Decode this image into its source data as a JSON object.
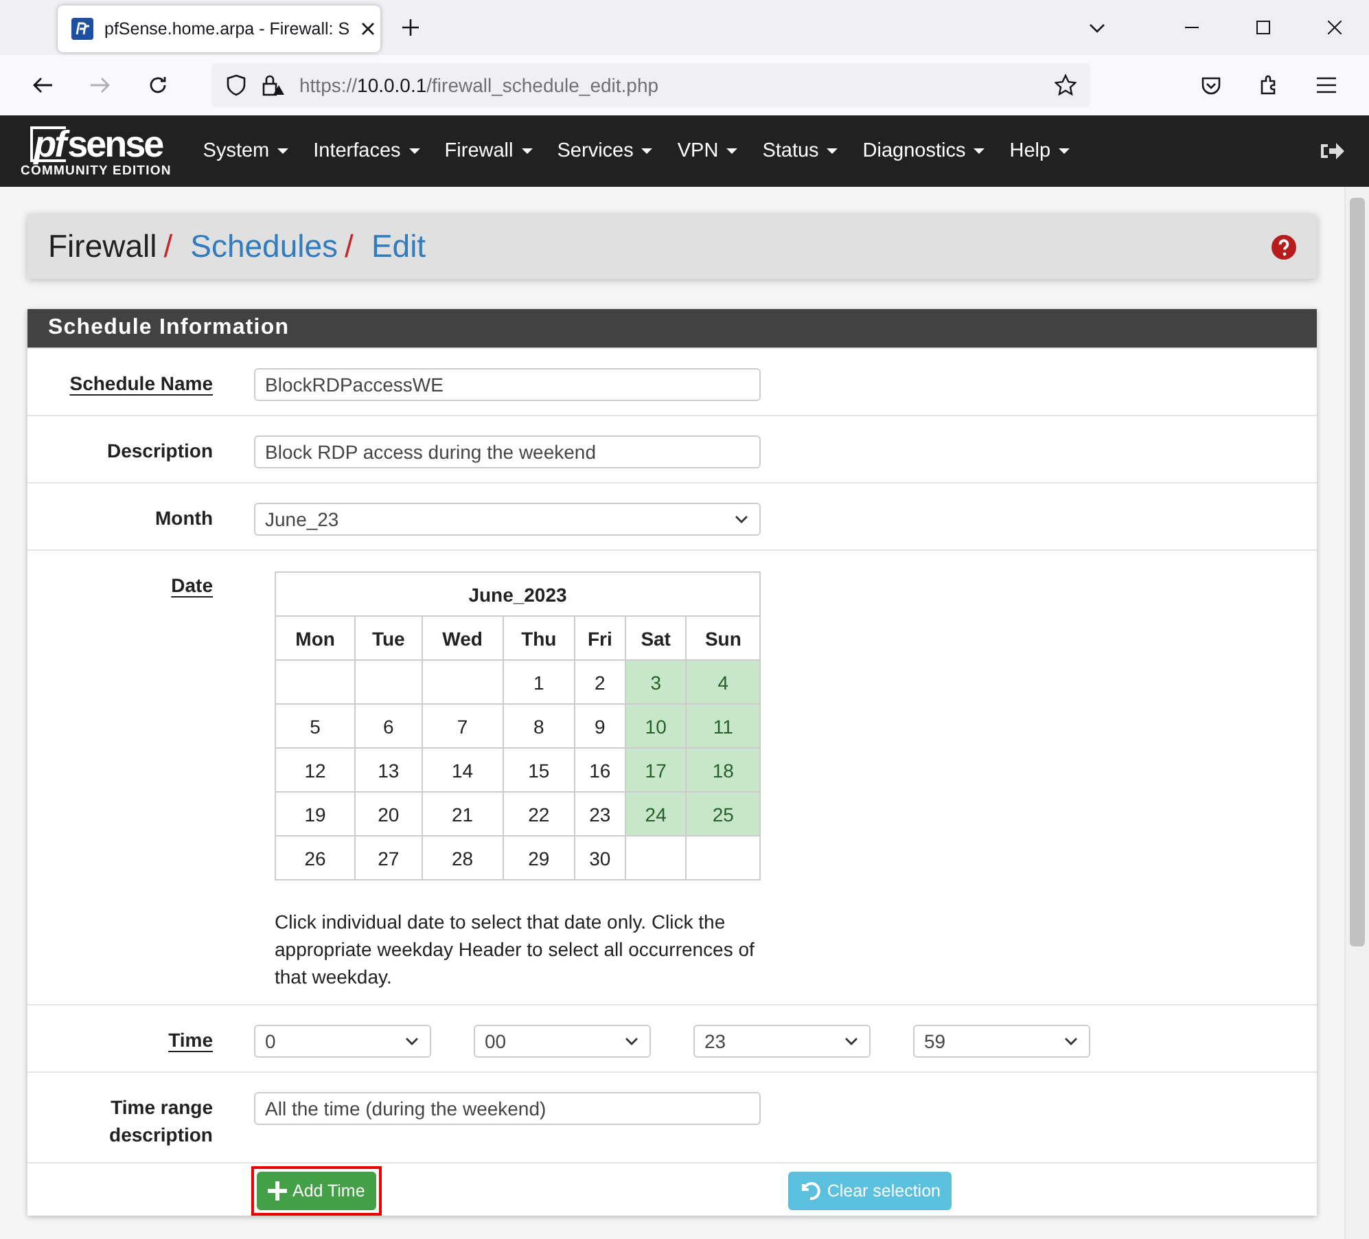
{
  "browser": {
    "tab_title": "pfSense.home.arpa - Firewall: S",
    "url": "https://10.0.0.1/firewall_schedule_edit.php"
  },
  "nav": {
    "logo": {
      "mark": "pf",
      "name": "sense",
      "edition": "COMMUNITY EDITION"
    },
    "items": [
      {
        "label": "System"
      },
      {
        "label": "Interfaces"
      },
      {
        "label": "Firewall"
      },
      {
        "label": "Services"
      },
      {
        "label": "VPN"
      },
      {
        "label": "Status"
      },
      {
        "label": "Diagnostics"
      },
      {
        "label": "Help"
      }
    ]
  },
  "breadcrumb": [
    {
      "label": "Firewall",
      "kind": "text",
      "separator": "/"
    },
    {
      "label": "Schedules",
      "kind": "link",
      "separator": "/"
    },
    {
      "label": "Edit",
      "kind": "link"
    }
  ],
  "panel": {
    "title": "Schedule Information",
    "rows": [
      {
        "kind": "text",
        "label": "Schedule Name",
        "required": true,
        "value": "BlockRDPaccessWE"
      },
      {
        "kind": "text",
        "label": "Description",
        "required": false,
        "value": "Block RDP access during the weekend"
      },
      {
        "kind": "select",
        "label": "Month",
        "required": false,
        "value": "June_23"
      },
      {
        "kind": "calendar",
        "label": "Date",
        "required": true,
        "calendar": {
          "title": "June_2023",
          "headers": [
            "Mon",
            "Tue",
            "Wed",
            "Thu",
            "Fri",
            "Sat",
            "Sun"
          ],
          "weeks": [
            [
              {
                "selected": false
              },
              {
                "selected": false
              },
              {
                "selected": false
              },
              {
                "day": "1",
                "selected": false
              },
              {
                "day": "2",
                "selected": false
              },
              {
                "day": "3",
                "selected": true
              },
              {
                "day": "4",
                "selected": true
              }
            ],
            [
              {
                "day": "5",
                "selected": false
              },
              {
                "day": "6",
                "selected": false
              },
              {
                "day": "7",
                "selected": false
              },
              {
                "day": "8",
                "selected": false
              },
              {
                "day": "9",
                "selected": false
              },
              {
                "day": "10",
                "selected": true
              },
              {
                "day": "11",
                "selected": true
              }
            ],
            [
              {
                "day": "12",
                "selected": false
              },
              {
                "day": "13",
                "selected": false
              },
              {
                "day": "14",
                "selected": false
              },
              {
                "day": "15",
                "selected": false
              },
              {
                "day": "16",
                "selected": false
              },
              {
                "day": "17",
                "selected": true
              },
              {
                "day": "18",
                "selected": true
              }
            ],
            [
              {
                "day": "19",
                "selected": false
              },
              {
                "day": "20",
                "selected": false
              },
              {
                "day": "21",
                "selected": false
              },
              {
                "day": "22",
                "selected": false
              },
              {
                "day": "23",
                "selected": false
              },
              {
                "day": "24",
                "selected": true
              },
              {
                "day": "25",
                "selected": true
              }
            ],
            [
              {
                "day": "26",
                "selected": false
              },
              {
                "day": "27",
                "selected": false
              },
              {
                "day": "28",
                "selected": false
              },
              {
                "day": "29",
                "selected": false
              },
              {
                "day": "30",
                "selected": false
              },
              {
                "selected": false
              },
              {
                "selected": false
              }
            ]
          ]
        },
        "help": "Click individual date to select that date only. Click the appropriate weekday Header to select all occurrences of that weekday."
      },
      {
        "kind": "time",
        "label": "Time",
        "required": true,
        "selects": [
          "0",
          "00",
          "23",
          "59"
        ]
      },
      {
        "kind": "text",
        "label": "Time range description",
        "required": false,
        "value": "All the time (during the weekend)"
      },
      {
        "kind": "buttons",
        "buttons": [
          {
            "label": "Add Time",
            "kind": "add",
            "highlighted": true
          },
          {
            "label": "Clear selection",
            "kind": "clear",
            "highlighted": false
          }
        ]
      }
    ]
  }
}
